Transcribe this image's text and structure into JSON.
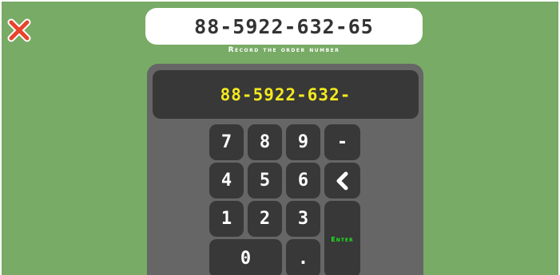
{
  "order_target": "88-5922-632-65",
  "instruction": "Record the order number",
  "entry_display": "88-5922-632-",
  "icons": {
    "close": "close-x-icon",
    "backspace": "chevron-left-icon"
  },
  "colors": {
    "background": "#78ab65",
    "close_icon": "#e8432b",
    "display_text": "#f4ea1f",
    "enter_label": "#1ee61e",
    "key": "#383838",
    "panel": "#666666"
  },
  "keys": {
    "k7": "7",
    "k8": "8",
    "k9": "9",
    "dash": "-",
    "k4": "4",
    "k5": "5",
    "k6": "6",
    "k1": "1",
    "k2": "2",
    "k3": "3",
    "enter": "Enter",
    "k0": "0",
    "dot": "."
  }
}
